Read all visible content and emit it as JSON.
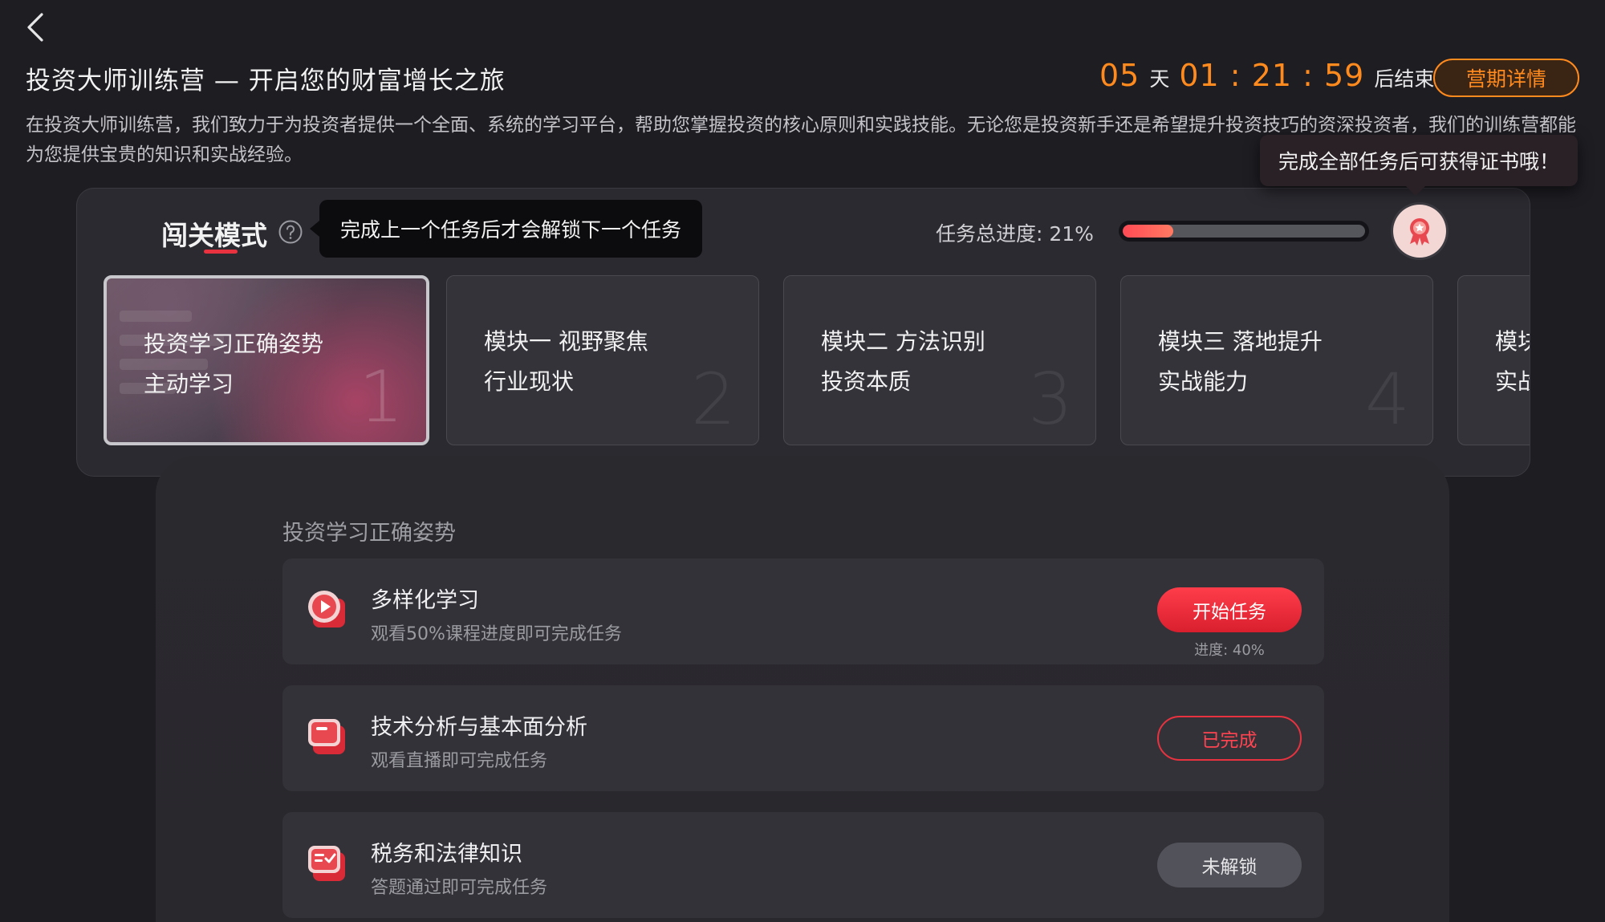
{
  "header": {
    "title": "投资大师训练营 — 开启您的财富增长之旅",
    "countdown": {
      "days": "05",
      "days_unit": "天",
      "time": "01 : 21 : 59",
      "suffix": "后结束"
    },
    "camp_details_button": "营期详情",
    "intro": "在投资大师训练营，我们致力于为投资者提供一个全面、系统的学习平台，帮助您掌握投资的核心原则和实践技能。无论您是投资新手还是希望提升投资技巧的资深投资者，我们的训练营都能为您提供宝贵的知识和实战经验。"
  },
  "certificate_tooltip": "完成全部任务后可获得证书哦！",
  "mode": {
    "title": "闯关模式",
    "tooltip": "完成上一个任务后才会解锁下一个任务",
    "progress_label": "任务总进度: 21%",
    "progress_value": 0.21
  },
  "modules": [
    {
      "title": "投资学习正确姿势",
      "subtitle": "主动学习",
      "number": "1",
      "active": true
    },
    {
      "title": "模块一 视野聚焦",
      "subtitle": "行业现状",
      "number": "2",
      "active": false
    },
    {
      "title": "模块二 方法识别",
      "subtitle": "投资本质",
      "number": "3",
      "active": false
    },
    {
      "title": "模块三 落地提升",
      "subtitle": "实战能力",
      "number": "4",
      "active": false
    },
    {
      "title": "模块",
      "subtitle": "实战",
      "number": "",
      "active": false
    }
  ],
  "section": {
    "title": "投资学习正确姿势",
    "tasks": [
      {
        "icon": "video-play-icon",
        "title": "多样化学习",
        "desc": "观看50%课程进度即可完成任务",
        "button": "开始任务",
        "status": "primary",
        "progress": "进度: 40%"
      },
      {
        "icon": "live-broadcast-icon",
        "title": "技术分析与基本面分析",
        "desc": "观看直播即可完成任务",
        "button": "已完成",
        "status": "done"
      },
      {
        "icon": "quiz-check-icon",
        "title": "税务和法律知识",
        "desc": "答题通过即可完成任务",
        "button": "未解锁",
        "status": "locked"
      }
    ]
  },
  "colors": {
    "accent_red": "#e8323f",
    "accent_orange": "#ff8a1e",
    "background": "#1d1d22"
  }
}
